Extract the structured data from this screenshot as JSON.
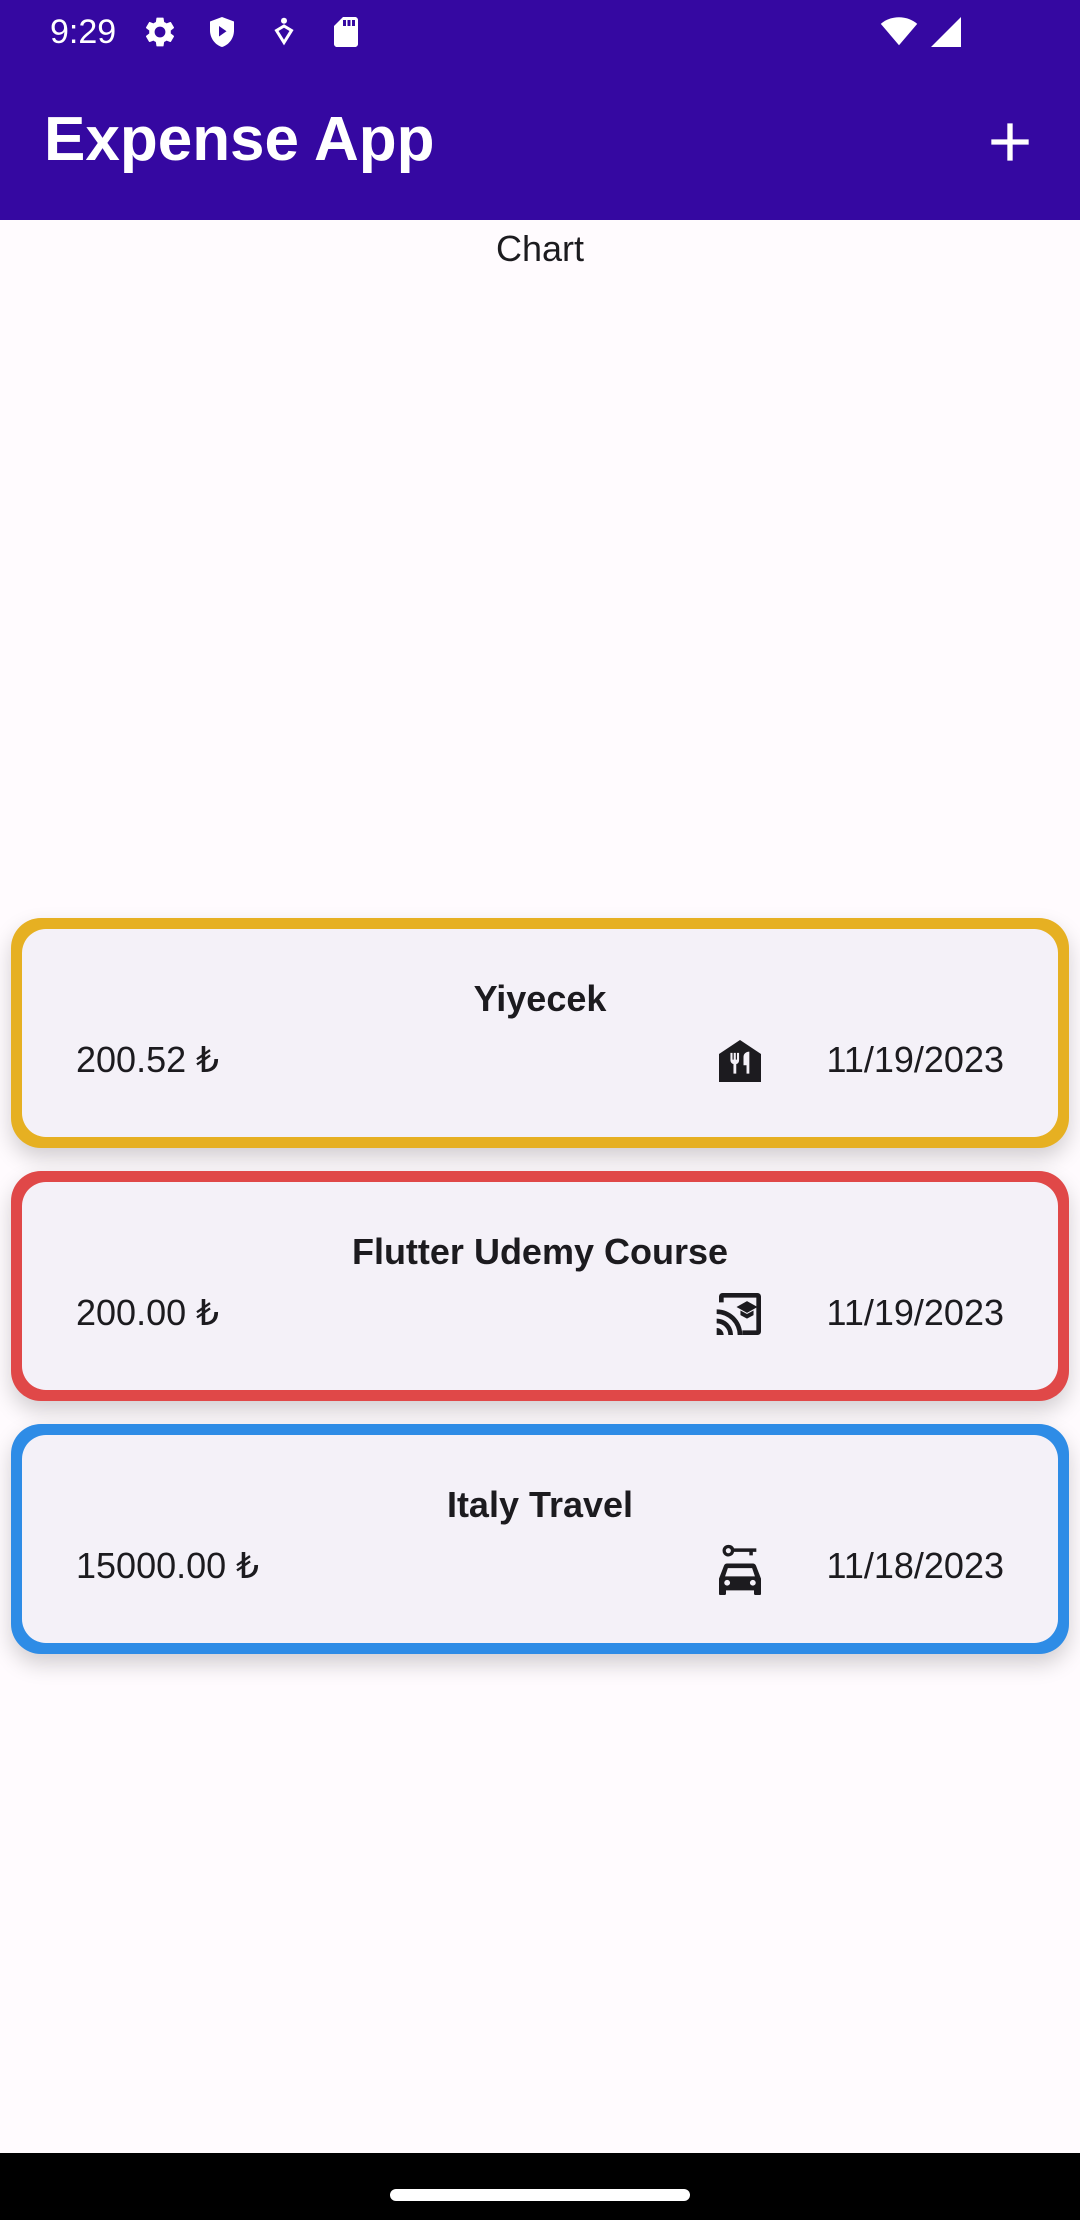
{
  "status_bar": {
    "time": "9:29"
  },
  "app_bar": {
    "title": "Expense App",
    "add_icon": "plus-icon"
  },
  "chart": {
    "label": "Chart"
  },
  "expenses": [
    {
      "title": "Yiyecek",
      "amount": "200.52 ₺",
      "date": "11/19/2023",
      "icon": "food-icon",
      "border_color": "#E6B022"
    },
    {
      "title": "Flutter Udemy Course",
      "amount": "200.00 ₺",
      "date": "11/19/2023",
      "icon": "cast-for-education-icon",
      "border_color": "#E04848"
    },
    {
      "title": "Italy Travel",
      "amount": "15000.00 ₺",
      "date": "11/18/2023",
      "icon": "car-rental-icon",
      "border_color": "#2E8CE6"
    }
  ],
  "colors": {
    "app_bar": "#3508A1",
    "background": "#FFFBFE",
    "card": "#F4F1F8"
  }
}
